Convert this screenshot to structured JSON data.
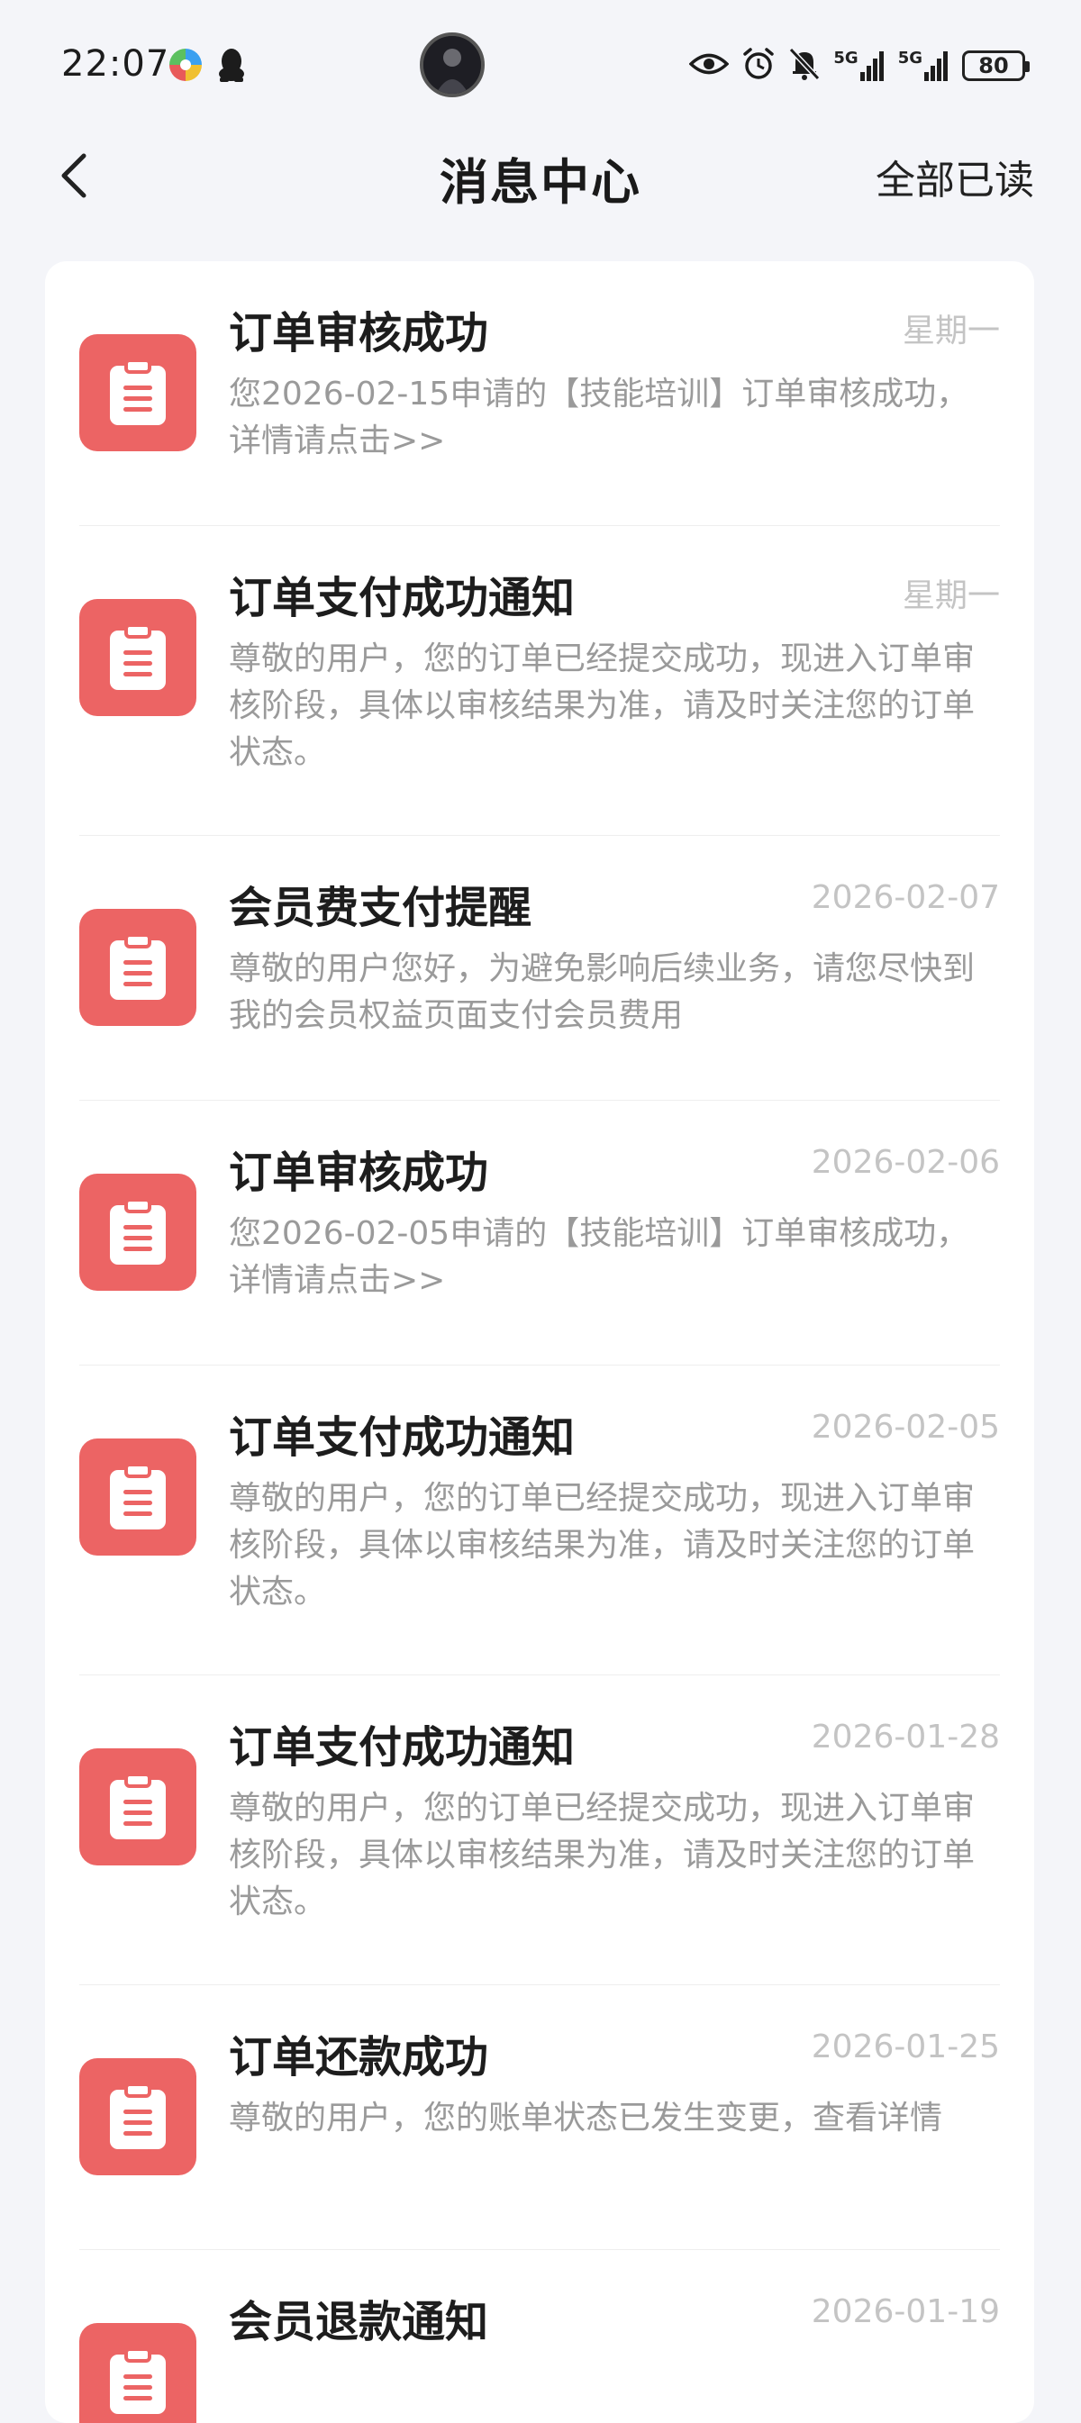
{
  "status_bar": {
    "time": "22:07",
    "network_1": "5G",
    "network_2": "5G",
    "battery": "80"
  },
  "header": {
    "title": "消息中心",
    "mark_all_read": "全部已读"
  },
  "colors": {
    "accent": "#ec6464",
    "background": "#f4f5f9",
    "card": "#ffffff",
    "title_text": "#1d1d1d",
    "body_text": "#9a9a9a",
    "date_text": "#c4c4c4"
  },
  "messages": [
    {
      "icon": "clipboard-icon",
      "title": "订单审核成功",
      "date": "星期一",
      "body": "您2026-02-15申请的【技能培训】订单审核成功，详情请点击>>"
    },
    {
      "icon": "clipboard-icon",
      "title": "订单支付成功通知",
      "date": "星期一",
      "body": "尊敬的用户，您的订单已经提交成功，现进入订单审核阶段，具体以审核结果为准，请及时关注您的订单状态。"
    },
    {
      "icon": "clipboard-icon",
      "title": "会员费支付提醒",
      "date": "2026-02-07",
      "body": "尊敬的用户您好，为避免影响后续业务，请您尽快到我的会员权益页面支付会员费用"
    },
    {
      "icon": "clipboard-icon",
      "title": "订单审核成功",
      "date": "2026-02-06",
      "body": "您2026-02-05申请的【技能培训】订单审核成功，详情请点击>>"
    },
    {
      "icon": "clipboard-icon",
      "title": "订单支付成功通知",
      "date": "2026-02-05",
      "body": "尊敬的用户，您的订单已经提交成功，现进入订单审核阶段，具体以审核结果为准，请及时关注您的订单状态。"
    },
    {
      "icon": "clipboard-icon",
      "title": "订单支付成功通知",
      "date": "2026-01-28",
      "body": "尊敬的用户，您的订单已经提交成功，现进入订单审核阶段，具体以审核结果为准，请及时关注您的订单状态。"
    },
    {
      "icon": "clipboard-icon",
      "title": "订单还款成功",
      "date": "2026-01-25",
      "body": "尊敬的用户，您的账单状态已发生变更，查看详情"
    },
    {
      "icon": "clipboard-icon",
      "title": "会员退款通知",
      "date": "2026-01-19",
      "body": ""
    }
  ]
}
